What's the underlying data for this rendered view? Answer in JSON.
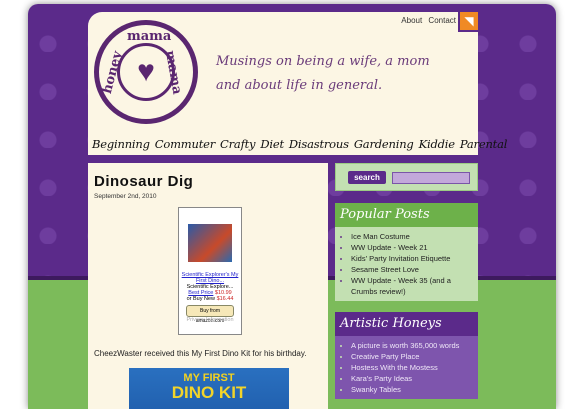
{
  "header": {
    "logo_text": [
      "mama",
      "mama",
      "honey"
    ],
    "tagline": "Musings on being a wife, a mom and about life in general.",
    "links": [
      "About",
      "Contact"
    ],
    "categories": [
      "Beginning",
      "Commuter",
      "Crafty",
      "Diet",
      "Disastrous",
      "Gardening",
      "Kiddie",
      "Parental"
    ]
  },
  "post": {
    "title": "Dinosaur Dig",
    "date": "September 2nd, 2010",
    "amazon": {
      "link": "Scientific Explorer's My First Dino...",
      "subtitle": "Scientific Explore...",
      "best_price_label": "Best Price",
      "best_price": "$10.99",
      "buy_new_label": "or Buy New",
      "buy_new": "$16.44",
      "button": "Buy from amazon.com",
      "privacy": "Privacy Information"
    },
    "body": "CheezWaster received this My First Dino Kit for his birthday.",
    "image_text": [
      "MY FIRST",
      "DINO KIT"
    ]
  },
  "sidebar": {
    "search_label": "search",
    "search_value": "",
    "popular": {
      "title": "Popular Posts",
      "items": [
        "Ice Man Costume",
        "WW Update - Week 21",
        "Kids' Party Invitation Etiquette",
        "Sesame Street Love",
        "WW Update - Week 35 (and a Crumbs review!)"
      ]
    },
    "artistic": {
      "title": "Artistic Honeys",
      "items": [
        "A picture is worth 365,000 words",
        "Creative Party Place",
        "Hostess With the Mostess",
        "Kara's Party Ideas",
        "Swanky Tables"
      ]
    }
  }
}
